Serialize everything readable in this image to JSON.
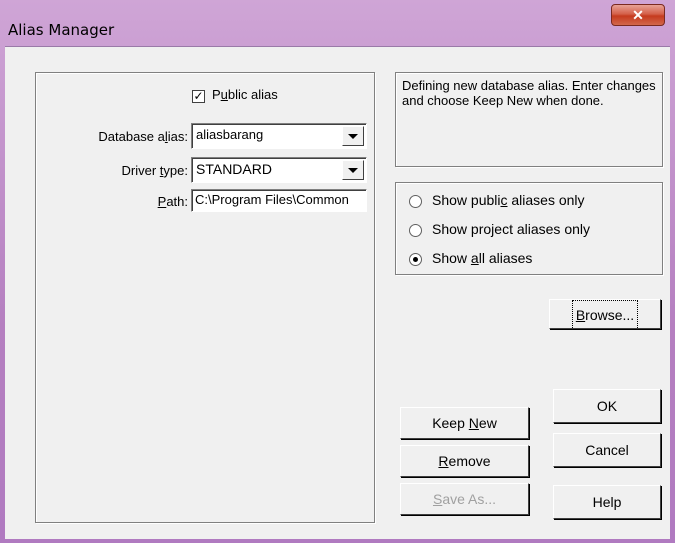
{
  "window": {
    "title": "Alias Manager"
  },
  "left": {
    "public_alias": {
      "label_pre": "P",
      "label_u": "u",
      "label_post": "blic alias",
      "checked": true,
      "check_glyph": "✓"
    },
    "database_alias": {
      "label_pre": "Database a",
      "label_u": "l",
      "label_post": "ias:",
      "value": "aliasbarang"
    },
    "driver_type": {
      "label_pre": "Driver ",
      "label_u": "t",
      "label_post": "ype:",
      "value": "STANDARD"
    },
    "path": {
      "label_u": "P",
      "label_post": "ath:",
      "value": "C:\\Program Files\\Common"
    }
  },
  "info": {
    "text": "Defining new database alias. Enter changes and choose Keep New when done."
  },
  "radios": [
    {
      "pre": "Show publi",
      "u": "c",
      "post": " aliases only",
      "selected": false
    },
    {
      "pre": "Show pro",
      "u": "j",
      "post": "ect aliases only",
      "selected": false
    },
    {
      "pre": "Show ",
      "u": "a",
      "post": "ll aliases",
      "selected": true
    }
  ],
  "buttons": {
    "browse": {
      "u": "B",
      "post": "rowse..."
    },
    "keep_new": {
      "pre": "Keep ",
      "u": "N",
      "post": "ew"
    },
    "remove": {
      "u": "R",
      "post": "emove"
    },
    "save_as": {
      "u": "S",
      "post": "ave As..."
    },
    "ok": "OK",
    "cancel": "Cancel",
    "help": "Help"
  }
}
